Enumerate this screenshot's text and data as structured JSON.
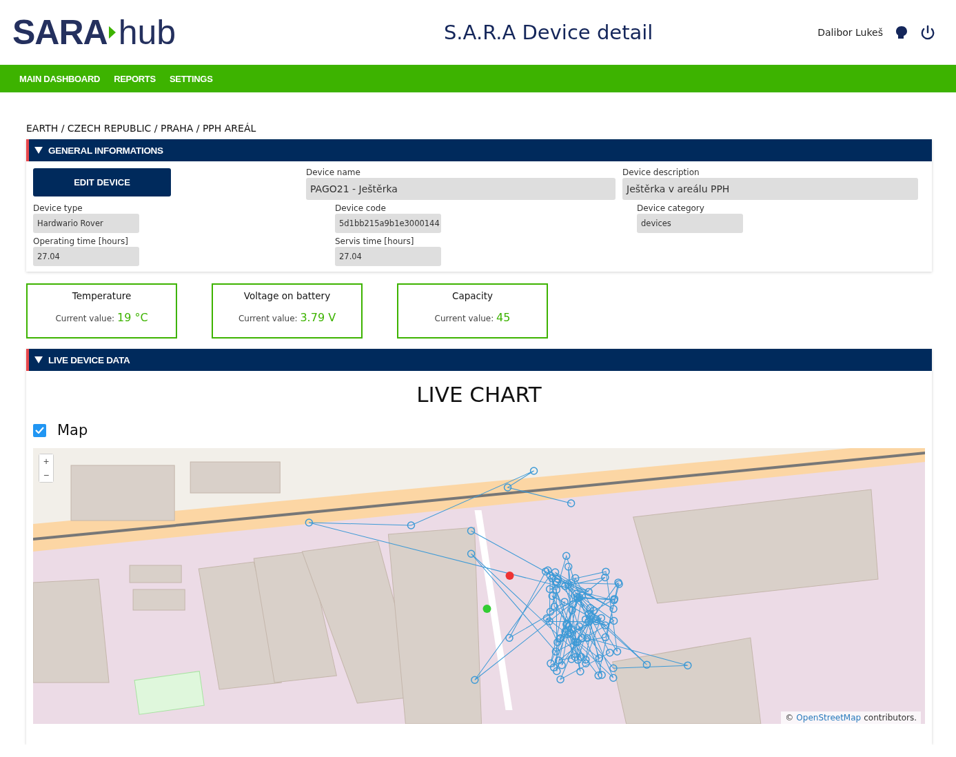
{
  "header": {
    "logo": {
      "primary": "SARA",
      "secondary": "hub"
    },
    "title": "S.A.R.A Device detail",
    "user_name": "Dalibor Lukeš"
  },
  "nav": [
    {
      "label": "MAIN DASHBOARD"
    },
    {
      "label": "REPORTS"
    },
    {
      "label": "SETTINGS"
    }
  ],
  "breadcrumb": "EARTH / CZECH REPUBLIC / PRAHA / PPH AREÁL",
  "general": {
    "title": "GENERAL INFORMATIONS",
    "expanded": true,
    "rows": [
      [
        {
          "kind": "button",
          "label": "EDIT DEVICE"
        },
        {
          "kind": "large",
          "label": "Device name",
          "value": "PAGO21 - Ještěrka"
        },
        {
          "kind": "large",
          "label": "Device description",
          "value": "Ještěrka v areálu PPH"
        }
      ],
      [
        {
          "kind": "small",
          "label": "Device type",
          "value": "Hardwario Rover"
        },
        {
          "kind": "small",
          "label": "Device code",
          "value": "5d1bb215a9b1e3000144"
        },
        {
          "kind": "small",
          "label": "Device category",
          "value": "devices"
        }
      ],
      [
        {
          "kind": "small",
          "label": "Operating time [hours]",
          "value": "27.04"
        },
        {
          "kind": "small",
          "label": "Servis time [hours]",
          "value": "27.04"
        }
      ]
    ]
  },
  "metrics": [
    {
      "label": "Temperature",
      "prefix": "Current value:",
      "value": "19 °C"
    },
    {
      "label": "Voltage on battery",
      "prefix": "Current value:",
      "value": "3.79 V"
    },
    {
      "label": "Capacity",
      "prefix": "Current value:",
      "value": "45"
    }
  ],
  "live": {
    "title": "LIVE DEVICE DATA",
    "expanded": true,
    "chart_title": "LIVE CHART",
    "map_toggle": {
      "label": "Map",
      "checked": true
    },
    "map": {
      "zoom_in": "+",
      "zoom_out": "−",
      "attribution": {
        "prefix": "©",
        "link": "OpenStreetMap",
        "suffix": "contributors."
      }
    }
  }
}
